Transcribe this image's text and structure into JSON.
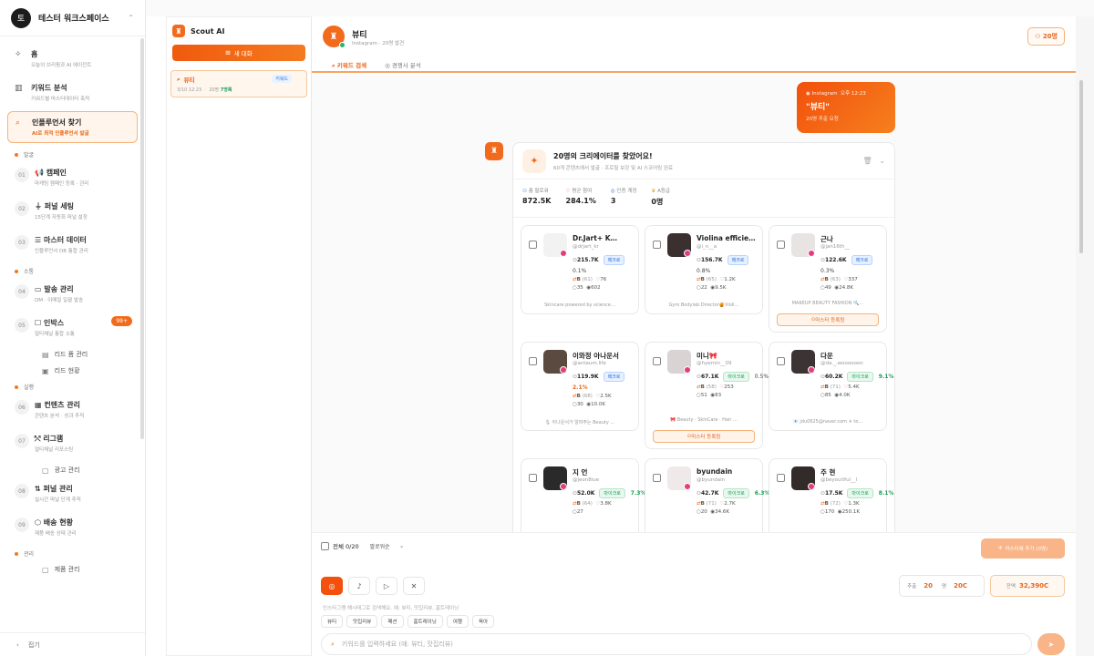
{
  "workspace": {
    "logo": "토",
    "name": "테스터 워크스페이스"
  },
  "nav": [
    {
      "key": "home",
      "title": "홈",
      "desc": "오늘의 브리핑과 AI 에이전트"
    },
    {
      "key": "kw",
      "title": "키워드 분석",
      "desc": "키워드별 마스터데이터 축적"
    },
    {
      "key": "find",
      "title": "인플루언서 찾기",
      "desc": "AI로 최적 인플루언서 발굴"
    }
  ],
  "sections": {
    "s1": "발굴",
    "s2": "소통",
    "s3": "실행",
    "s4": "관리"
  },
  "steps": [
    {
      "num": "01",
      "title": "캠페인",
      "desc": "마케팅 캠페인 등록 · 관리"
    },
    {
      "num": "02",
      "title": "퍼널 세팅",
      "desc": "15단계 자동화 퍼널 설정"
    },
    {
      "num": "03",
      "title": "마스터 데이터",
      "desc": "인플루언서 DB 통합 관리"
    },
    {
      "num": "04",
      "title": "발송 관리",
      "desc": "DM · 이메일 일괄 발송"
    },
    {
      "num": "05",
      "title": "인박스",
      "desc": "멀티채널 통합 소통",
      "badge": "99+"
    },
    {
      "num": "06",
      "title": "컨텐츠 관리",
      "desc": "콘텐츠 분석 · 성과 추적"
    },
    {
      "num": "07",
      "title": "리그램",
      "desc": "멀티채널 리포스팅"
    },
    {
      "num": "08",
      "title": "퍼널 관리",
      "desc": "실시간 퍼널 단계 추적"
    },
    {
      "num": "09",
      "title": "배송 현황",
      "desc": "제품 배송 상태 관리"
    }
  ],
  "subs": {
    "lead_form": "리드 폼 관리",
    "lead_status": "리드 현황",
    "ad": "광고 관리",
    "last": "제품 관리"
  },
  "collapse": "접기",
  "panel2": {
    "title": "Scout AI",
    "new_chat": "새 대화",
    "item": {
      "title": "뷰티",
      "tag": "키워드",
      "date": "3/10 12:23",
      "count": "20명",
      "status": "7명록"
    }
  },
  "header": {
    "title": "뷰티",
    "sub": "Instagram · 20명 발견",
    "count": "20명",
    "tab1": "키워드 검색",
    "tab2": "경쟁사 분석"
  },
  "bubble": {
    "platform": "Instagram",
    "time": "오후 12:23",
    "query": "\"뷰티\"",
    "sub": "20명 추출 요청"
  },
  "result": {
    "title": "20명의 크리에이터를 찾았어요!",
    "sub": "60개 콘텐츠에서 발굴 · 프로필 보강 및 AI 스코어링 완료",
    "stats": [
      {
        "l": "총 팔로워",
        "v": "872.5K"
      },
      {
        "l": "평균 참여",
        "v": "284.1%"
      },
      {
        "l": "인증 계정",
        "v": "3"
      },
      {
        "l": "A등급",
        "v": "0명"
      }
    ]
  },
  "creators": [
    {
      "name": "Dr.Jart+ K…",
      "handle": "@drjart_kr",
      "followers": "215.7K",
      "tier": "매크로",
      "tierClass": "macro",
      "er": "0.1%",
      "erClass": "",
      "grade": "B",
      "score": "(61)",
      "likes": "76",
      "comments": "35",
      "views": "602",
      "bio": "Skincare powered by science…",
      "master": ""
    },
    {
      "name": "Violina efficie…",
      "handle": "@i_n__a",
      "followers": "156.7K",
      "tier": "매크로",
      "tierClass": "macro",
      "er": "0.8%",
      "erClass": "",
      "grade": "B",
      "score": "(65)",
      "likes": "1.2K",
      "comments": "22",
      "views": "9.5K",
      "bio": "Gyro Bodylab Director🍯Violi…",
      "master": ""
    },
    {
      "name": "근나",
      "handle": "@jan16th__",
      "followers": "122.6K",
      "tier": "매크로",
      "tierClass": "macro",
      "er": "0.3%",
      "erClass": "",
      "grade": "B",
      "score": "(63)",
      "likes": "337",
      "comments": "49",
      "views": "24.8K",
      "bio": "MAKEUP BEAUTY FASHION 🔍…",
      "master": "마스터 등록됨"
    },
    {
      "name": "이와정 아나운서",
      "handle": "@antaum.life",
      "followers": "119.9K",
      "tier": "매크로",
      "tierClass": "macro",
      "er": "2.1%",
      "erClass": "hi",
      "grade": "B",
      "score": "(68)",
      "likes": "2.5K",
      "comments": "30",
      "views": "10.0K",
      "bio": "🎙 아나운서가 알려주는 Beauty …",
      "master": ""
    },
    {
      "name": "미니🎀",
      "handle": "@hyemin__09",
      "followers": "67.1K",
      "tier": "마이크로",
      "tierClass": "micro",
      "er": "0.5%",
      "erClass": "",
      "grade": "B",
      "score": "(58)",
      "likes": "253",
      "comments": "51",
      "views": "83",
      "bio": "🎀 Beauty · SkinCare · Hair …",
      "master": "마스터 등록됨"
    },
    {
      "name": "다운",
      "handle": "@da._.woooooon",
      "followers": "60.2K",
      "tier": "마이크로",
      "tierClass": "micro",
      "er": "9.1%",
      "erClass": "gr",
      "grade": "B",
      "score": "(71)",
      "likes": "5.4K",
      "comments": "85",
      "views": "4.0K",
      "bio": "📧 jdu0625@naver.com ✈ to…",
      "master": ""
    },
    {
      "name": "지 언",
      "handle": "@jeon8iue",
      "followers": "52.0K",
      "tier": "마이크로",
      "tierClass": "micro",
      "er": "7.3%",
      "erClass": "gr",
      "grade": "B",
      "score": "(64)",
      "likes": "3.8K",
      "comments": "27",
      "views": "",
      "bio": "",
      "master": ""
    },
    {
      "name": "byundain",
      "handle": "@byundain",
      "followers": "42.7K",
      "tier": "마이크로",
      "tierClass": "micro",
      "er": "6.3%",
      "erClass": "gr",
      "grade": "B",
      "score": "(71)",
      "likes": "2.7K",
      "comments": "20",
      "views": "34.6K",
      "bio": "",
      "master": ""
    },
    {
      "name": "주 현",
      "handle": "@beyoutiful__l",
      "followers": "17.5K",
      "tier": "마이크로",
      "tierClass": "micro",
      "er": "8.1%",
      "erClass": "gr",
      "grade": "B",
      "score": "(72)",
      "likes": "1.3K",
      "comments": "170",
      "views": "250.1K",
      "bio": "",
      "master": ""
    }
  ],
  "bottom": {
    "select_all": "전체 0/20",
    "sort": "팔로워순",
    "add": "마스터에 추가 (0명)",
    "cost_label": "추출",
    "cost_count": "20",
    "cost_unit": "명",
    "cost_value": "20C",
    "balance_label": "잔액",
    "balance": "32,390C",
    "hint": "인스타그램 해시태그로 검색해요. 예: 뷰티, 맛집리뷰, 홈트레이닝",
    "chips": [
      "뷰티",
      "맛집리뷰",
      "패션",
      "홈트레이닝",
      "여행",
      "육아"
    ],
    "placeholder": "키워드를 입력하세요 (예: 뷰티, 맛집리뷰)"
  }
}
